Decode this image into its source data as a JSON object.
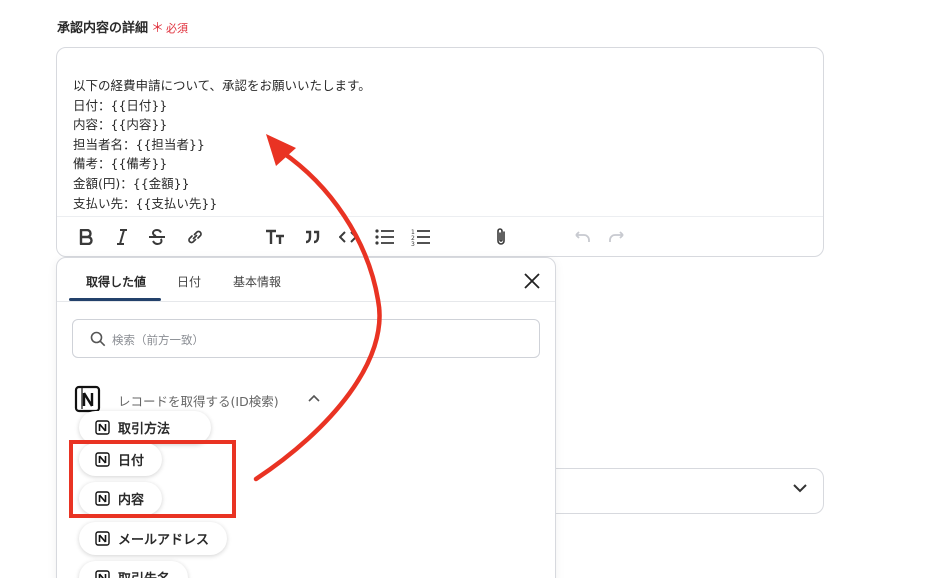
{
  "field": {
    "label": "承認内容の詳細",
    "required_mark": "＊",
    "required_text": "必須"
  },
  "editor": {
    "lines": [
      "以下の経費申請について、承認をお願いいたします。",
      "日付：{{日付}}",
      "内容：{{内容}}",
      "担当者名：{{担当者}}",
      "備考：{{備考}}",
      "金額(円)：{{金額}}",
      "支払い先：{{支払い先}}"
    ],
    "toolbar_icons": [
      "bold-icon",
      "italic-icon",
      "strikethrough-icon",
      "link-icon",
      "text-size-icon",
      "quote-icon",
      "code-icon",
      "bullet-list-icon",
      "numbered-list-icon",
      "attachment-icon",
      "undo-icon",
      "redo-icon"
    ]
  },
  "panel": {
    "tabs": [
      {
        "label": "取得した値"
      },
      {
        "label": "日付"
      },
      {
        "label": "基本情報"
      }
    ],
    "search_placeholder": "検索（前方一致）",
    "group_label": "レコードを取得する(ID検索)",
    "items": [
      {
        "label": "取引方法"
      },
      {
        "label": "日付"
      },
      {
        "label": "内容"
      },
      {
        "label": "メールアドレス"
      },
      {
        "label": "取引先名"
      }
    ]
  },
  "colors": {
    "accent": "#23416b",
    "required": "#e0303c",
    "annotation": "#e93323"
  }
}
